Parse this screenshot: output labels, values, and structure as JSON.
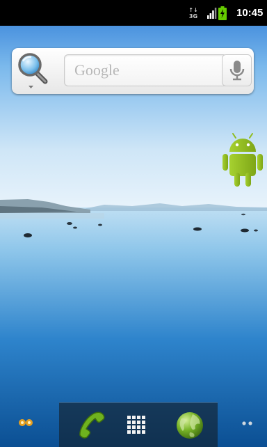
{
  "status_bar": {
    "data_type": "3G",
    "data_arrows": "↑↓",
    "time": "10:45",
    "icons": [
      "data-activity-icon",
      "signal-icon",
      "battery-charging-icon"
    ]
  },
  "search_widget": {
    "placeholder": "Google",
    "source_icon": "magnifier-icon",
    "voice_icon": "microphone-icon"
  },
  "home_widgets": {
    "android_icon": "android-robot-icon"
  },
  "dock": {
    "items": [
      {
        "name": "phone",
        "icon": "phone-handset-icon"
      },
      {
        "name": "apps",
        "icon": "app-grid-icon"
      },
      {
        "name": "browser",
        "icon": "globe-icon"
      }
    ]
  },
  "page_indicators": {
    "left": "page-dots-left-icon",
    "right": "page-dots-right-icon"
  },
  "colors": {
    "status_bar_bg": "#000000",
    "battery_green": "#66cc00",
    "android_green": "#97c024",
    "sky_top": "#2f7fd8",
    "water": "#1c6fbf"
  }
}
